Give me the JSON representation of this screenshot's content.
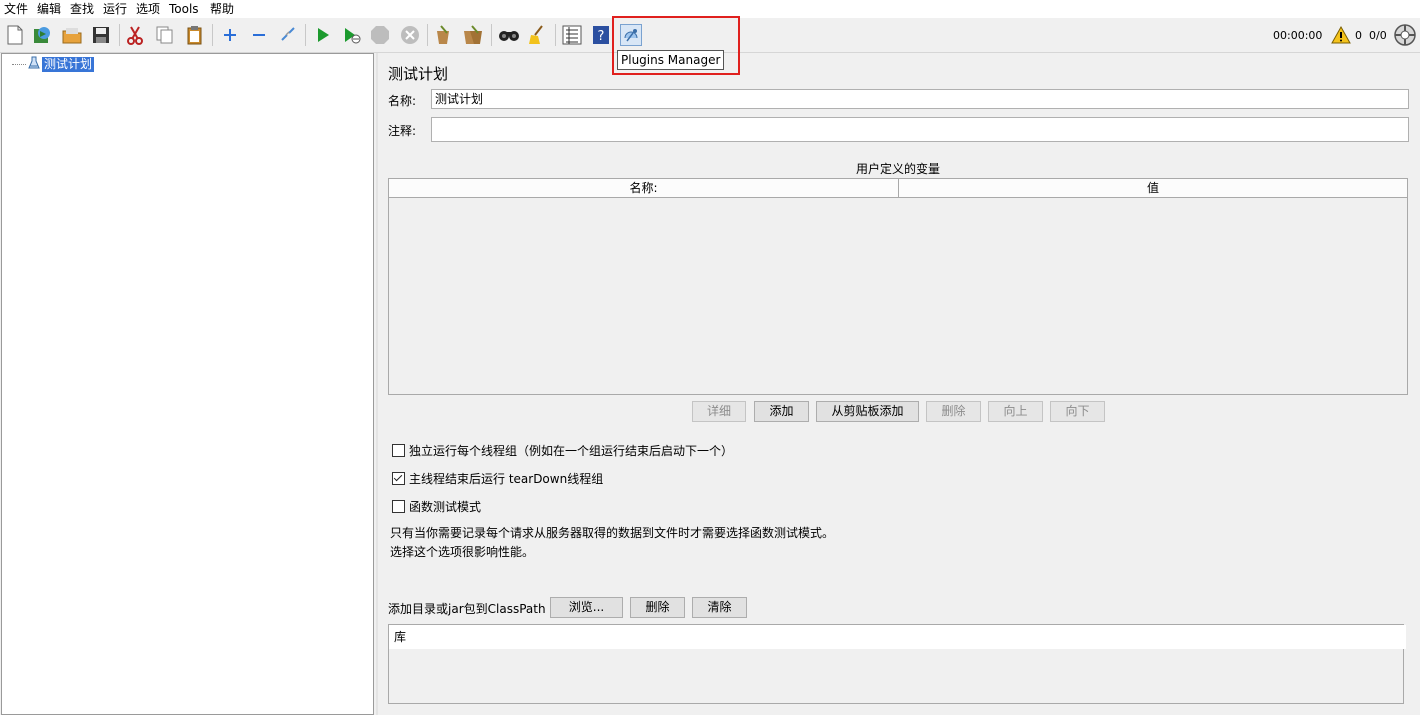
{
  "menu": [
    "文件",
    "编辑",
    "查找",
    "运行",
    "选项",
    "Tools",
    "帮助"
  ],
  "toolbar": {
    "icons": [
      "new-file-icon",
      "templates-icon",
      "open-icon",
      "save-icon",
      "cut-icon",
      "copy-icon",
      "paste-icon",
      "expand-icon",
      "collapse-icon",
      "toggle-icon",
      "start-icon",
      "start-no-pause-icon",
      "stop-icon",
      "shutdown-icon",
      "clear-icon",
      "clear-all-icon",
      "search-icon",
      "reset-search-icon",
      "function-helper-icon",
      "help-icon",
      "plugins-manager-icon"
    ],
    "tooltip": "Plugins Manager",
    "timer": "00:00:00",
    "warnings": "0",
    "threads": "0/0"
  },
  "tree": {
    "root_label": "测试计划"
  },
  "plan": {
    "title": "测试计划",
    "name_label": "名称:",
    "name_value": "测试计划",
    "comment_label": "注释:",
    "comment_value": "",
    "vars_title": "用户定义的变量",
    "columns": [
      "名称:",
      "值"
    ],
    "buttons": {
      "detail": "详细",
      "add": "添加",
      "add_clipboard": "从剪贴板添加",
      "delete": "删除",
      "up": "向上",
      "down": "向下"
    },
    "options": {
      "independent": "独立运行每个线程组（例如在一个组运行结束后启动下一个）",
      "teardown": "主线程结束后运行 tearDown线程组",
      "functional": "函数测试模式"
    },
    "note_line1": "只有当你需要记录每个请求从服务器取得的数据到文件时才需要选择函数测试模式。",
    "note_line2": "选择这个选项很影响性能。",
    "classpath_label": "添加目录或jar包到ClassPath",
    "browse": "浏览...",
    "cp_delete": "删除",
    "cp_clear": "清除",
    "lib_header": "库"
  }
}
